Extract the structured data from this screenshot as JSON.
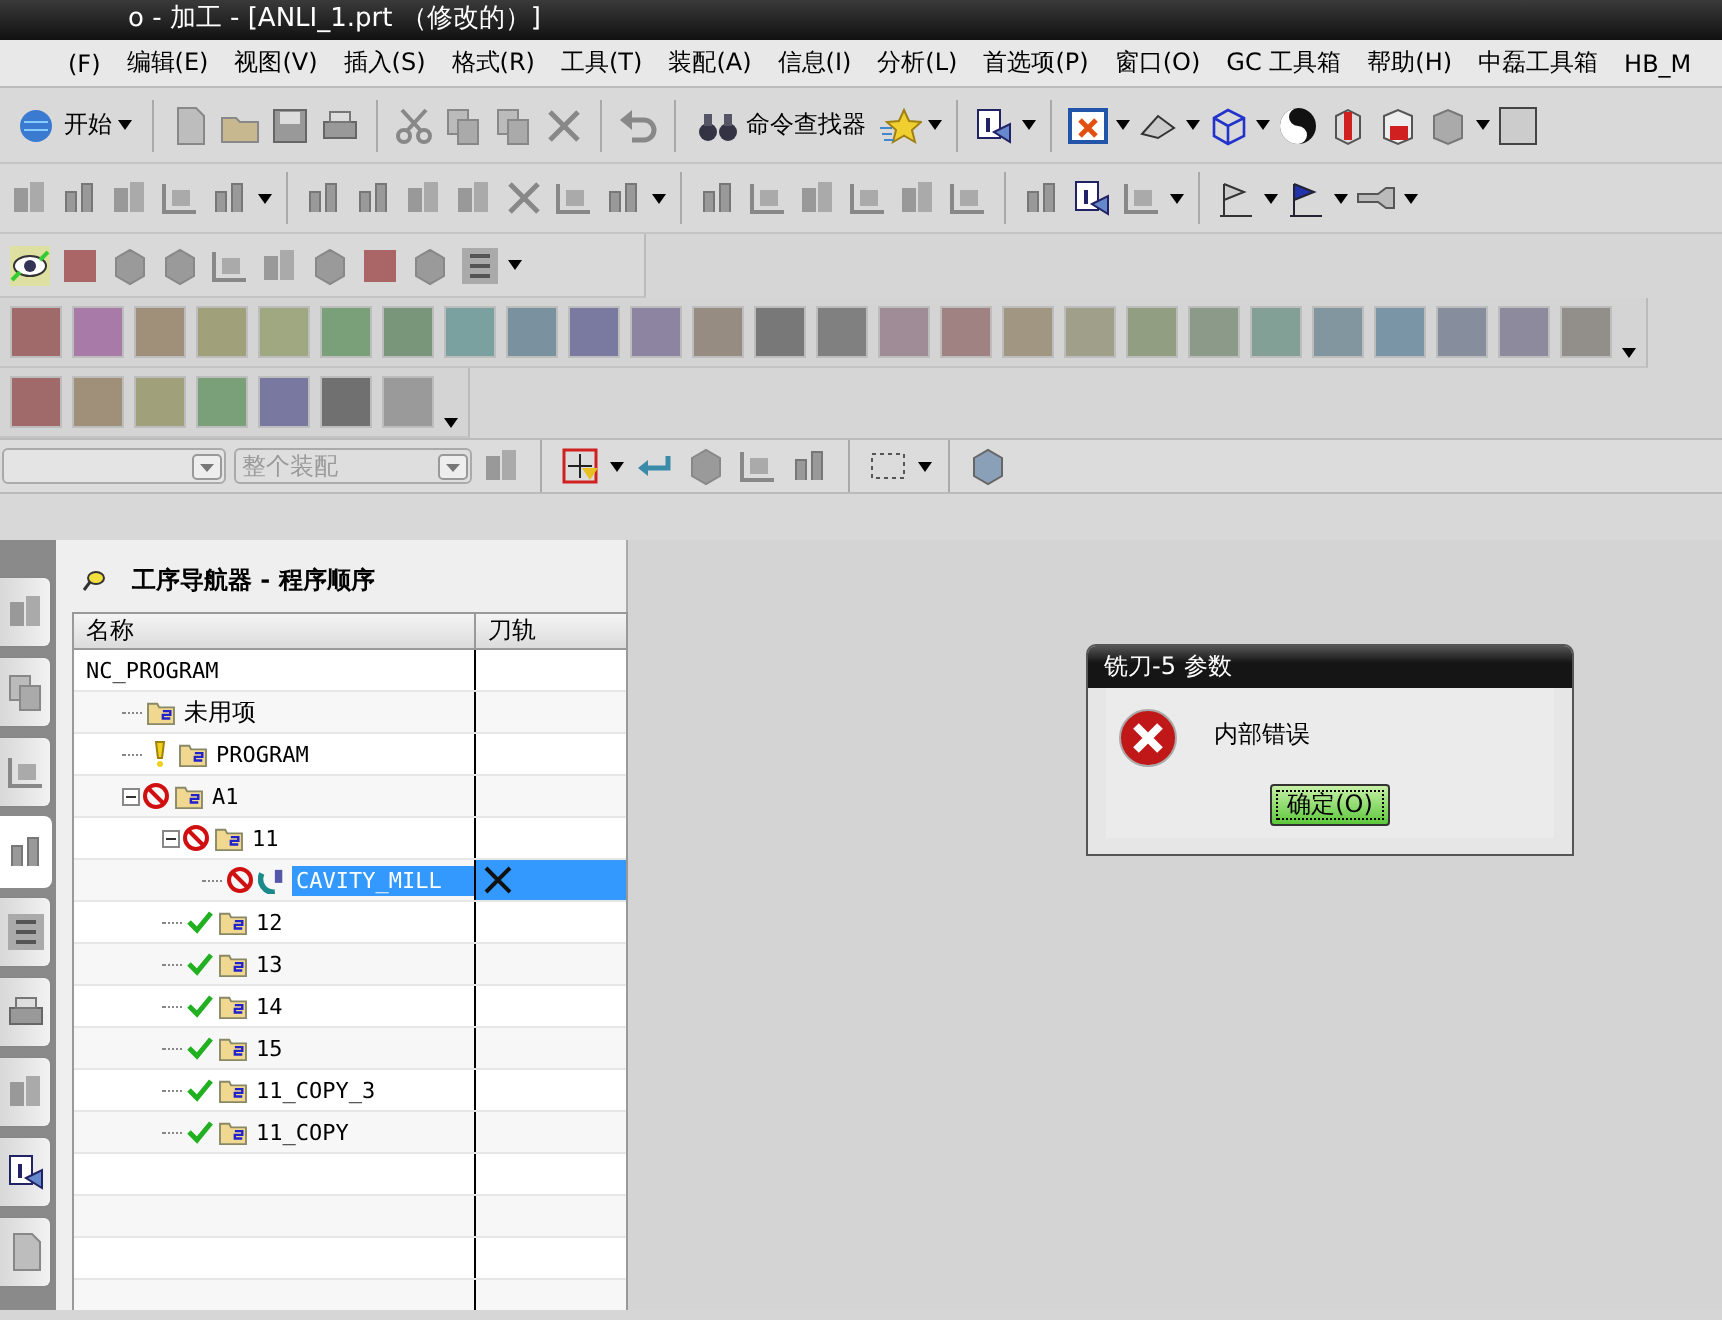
{
  "window": {
    "title": "o - 加工 - [ANLI_1.prt （修改的）]"
  },
  "menu": [
    "(F)",
    "编辑(E)",
    "视图(V)",
    "插入(S)",
    "格式(R)",
    "工具(T)",
    "装配(A)",
    "信息(I)",
    "分析(L)",
    "首选项(P)",
    "窗口(O)",
    "GC 工具箱",
    "帮助(H)",
    "中磊工具箱",
    "HB_M"
  ],
  "toolbar": {
    "start_button": "开始",
    "command_finder": "命令查找器"
  },
  "palette_rows": [
    {
      "swatches": [
        {
          "color": "#a06a6a"
        },
        {
          "color": "#a87aa8"
        },
        {
          "color": "#a0907a"
        },
        {
          "color": "#a0a07a"
        },
        {
          "color": "#a0a882"
        },
        {
          "color": "#7aa07a"
        },
        {
          "color": "#7a967a"
        },
        {
          "color": "#7aa0a0"
        },
        {
          "color": "#7a92a0"
        },
        {
          "color": "#7a7aa0"
        },
        {
          "color": "#8c84a0"
        },
        {
          "color": "#968c82"
        },
        {
          "color": "#787878"
        },
        {
          "color": "#808080"
        },
        {
          "color": "#a08c96"
        },
        {
          "color": "#a08282"
        },
        {
          "color": "#a09682"
        },
        {
          "color": "#a0a08a"
        },
        {
          "color": "#929e82"
        },
        {
          "color": "#8c9a8a"
        },
        {
          "color": "#82a096"
        },
        {
          "color": "#8296a0"
        },
        {
          "color": "#7a96a6"
        },
        {
          "color": "#868e9e"
        },
        {
          "color": "#8e8a9e"
        },
        {
          "color": "#928e8a"
        }
      ]
    },
    {
      "swatches": [
        {
          "color": "#a06a6a"
        },
        {
          "color": "#a0907a"
        },
        {
          "color": "#a0a07a"
        },
        {
          "color": "#7aa07a"
        },
        {
          "color": "#7878a0"
        },
        {
          "color": "#707070"
        },
        {
          "color": "#9a9a9a"
        }
      ]
    }
  ],
  "selection_bar": {
    "scope_dropdown": {
      "value": "整个装配",
      "disabled": true
    }
  },
  "side_tabs": [
    {
      "selected": false
    },
    {
      "selected": false
    },
    {
      "selected": false
    },
    {
      "selected": true
    },
    {
      "selected": false
    },
    {
      "selected": false
    },
    {
      "selected": false
    },
    {
      "selected": false
    },
    {
      "selected": false
    }
  ],
  "navigator": {
    "title": "工序导航器 - 程序顺序",
    "columns": [
      "名称",
      "刀轨"
    ],
    "tree": [
      {
        "label": "NC_PROGRAM",
        "selected": false,
        "children": [
          {
            "label": "未用项",
            "kind": "group",
            "failed": false,
            "complete": false,
            "warning": false,
            "selected": false,
            "toolpath_missing": false
          },
          {
            "label": "PROGRAM",
            "kind": "group",
            "failed": false,
            "complete": false,
            "warning": true,
            "selected": false,
            "toolpath_missing": false
          },
          {
            "label": "A1",
            "kind": "group",
            "failed": true,
            "complete": false,
            "warning": false,
            "selected": false,
            "toolpath_missing": false,
            "expanded": true,
            "children": [
              {
                "label": "11",
                "kind": "group",
                "failed": true,
                "complete": false,
                "warning": false,
                "selected": false,
                "toolpath_missing": false,
                "expanded": true,
                "children": [
                  {
                    "label": "CAVITY_MILL",
                    "kind": "operation",
                    "failed": true,
                    "complete": false,
                    "warning": false,
                    "selected": true,
                    "toolpath_missing": true
                  }
                ]
              },
              {
                "label": "12",
                "kind": "group",
                "failed": false,
                "complete": true,
                "warning": false,
                "selected": false,
                "toolpath_missing": false
              },
              {
                "label": "13",
                "kind": "group",
                "failed": false,
                "complete": true,
                "warning": false,
                "selected": false,
                "toolpath_missing": false
              },
              {
                "label": "14",
                "kind": "group",
                "failed": false,
                "complete": true,
                "warning": false,
                "selected": false,
                "toolpath_missing": false
              },
              {
                "label": "15",
                "kind": "group",
                "failed": false,
                "complete": true,
                "warning": false,
                "selected": false,
                "toolpath_missing": false
              },
              {
                "label": "11_COPY_3",
                "kind": "group",
                "failed": false,
                "complete": true,
                "warning": false,
                "selected": false,
                "toolpath_missing": false
              },
              {
                "label": "11_COPY",
                "kind": "group",
                "failed": false,
                "complete": true,
                "warning": false,
                "selected": false,
                "toolpath_missing": false
              }
            ]
          }
        ]
      }
    ]
  },
  "dialog": {
    "title": "铣刀-5 参数",
    "message": "内部错误",
    "button": "确定(O)"
  }
}
